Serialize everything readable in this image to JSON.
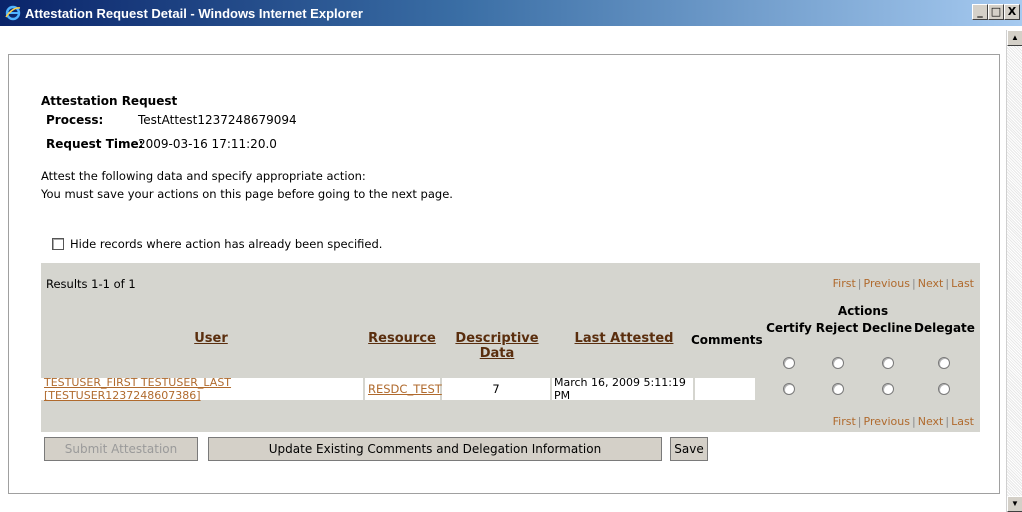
{
  "window": {
    "title": "Attestation Request Detail - Windows Internet Explorer",
    "buttons": [
      "_",
      "□",
      "X"
    ]
  },
  "section_title": "Attestation Request",
  "fields": {
    "process_label": "Process:",
    "process_value": "TestAttest1237248679094",
    "request_time_label": "Request Time:",
    "request_time_value": "2009-03-16 17:11:20.0"
  },
  "instructions": {
    "line1": "Attest the following data and specify appropriate action:",
    "line2": "You must save your actions on this page before going to the next page."
  },
  "hide_records": {
    "label": "Hide records where action has already been specified.",
    "checked": false
  },
  "results": {
    "count_text": "Results 1-1 of 1",
    "pager": {
      "first": "First",
      "previous": "Previous",
      "next": "Next",
      "last": "Last",
      "sep": "|"
    },
    "columns": {
      "user": "User",
      "resource": "Resource",
      "descriptive_data": "Descriptive Data",
      "last_attested": "Last Attested",
      "comments": "Comments",
      "actions_group": "Actions",
      "certify": "Certify",
      "reject": "Reject",
      "decline": "Decline",
      "delegate": "Delegate"
    },
    "rows": [
      {
        "user": "TESTUSER_FIRST TESTUSER_LAST [TESTUSER1237248607386]",
        "resource": "RESDC_TEST",
        "descriptive_data": "7",
        "last_attested": "March 16, 2009 5:11:19 PM",
        "comments": ""
      }
    ]
  },
  "buttons": {
    "submit": "Submit Attestation",
    "update": "Update Existing Comments and Delegation Information",
    "save": "Save"
  },
  "colors": {
    "link": "#b06a2d",
    "header_link": "#5a2e0e",
    "panel_bg": "#d5d5cf",
    "titlebar_start": "#0a246a"
  }
}
